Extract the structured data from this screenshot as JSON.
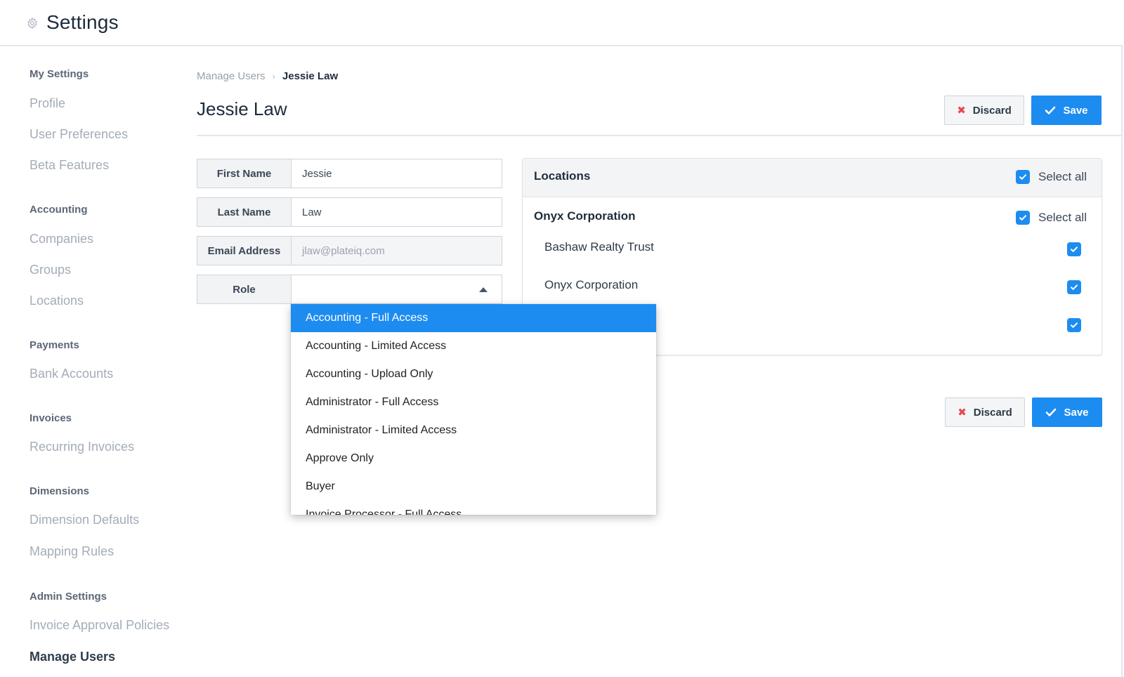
{
  "header": {
    "title": "Settings",
    "icon": "gear-icon"
  },
  "sidebar": {
    "sections": [
      {
        "title": "My Settings",
        "items": [
          "Profile",
          "User Preferences",
          "Beta Features"
        ]
      },
      {
        "title": "Accounting",
        "items": [
          "Companies",
          "Groups",
          "Locations"
        ]
      },
      {
        "title": "Payments",
        "items": [
          "Bank Accounts"
        ]
      },
      {
        "title": "Invoices",
        "items": [
          "Recurring Invoices"
        ]
      },
      {
        "title": "Dimensions",
        "items": [
          "Dimension Defaults",
          "Mapping Rules"
        ]
      },
      {
        "title": "Admin Settings",
        "items": [
          "Invoice Approval Policies",
          "Manage Users"
        ]
      }
    ],
    "active_item": "Manage Users"
  },
  "breadcrumb": {
    "parent": "Manage Users",
    "separator": "›",
    "current": "Jessie Law"
  },
  "page": {
    "title": "Jessie Law"
  },
  "actions": {
    "discard_label": "Discard",
    "save_label": "Save"
  },
  "form": {
    "first_name": {
      "label": "First Name",
      "value": "Jessie"
    },
    "last_name": {
      "label": "Last Name",
      "value": "Law"
    },
    "email": {
      "label": "Email Address",
      "value": "jlaw@plateiq.com"
    },
    "role": {
      "label": "Role",
      "value": ""
    }
  },
  "role_dropdown": {
    "options": [
      "Accounting - Full Access",
      "Accounting - Limited Access",
      "Accounting - Upload Only",
      "Administrator - Full Access",
      "Administrator - Limited Access",
      "Approve Only",
      "Buyer",
      "Invoice Processor - Full Access"
    ],
    "highlighted": "Accounting - Full Access"
  },
  "locations": {
    "title": "Locations",
    "select_all_label": "Select all",
    "group": {
      "name": "Onyx Corporation",
      "select_all_label": "Select all",
      "items": [
        "Bashaw Realty Trust",
        "Onyx Corporation",
        ""
      ]
    }
  },
  "colors": {
    "accent": "#1d8cf0",
    "danger": "#e5484d"
  }
}
